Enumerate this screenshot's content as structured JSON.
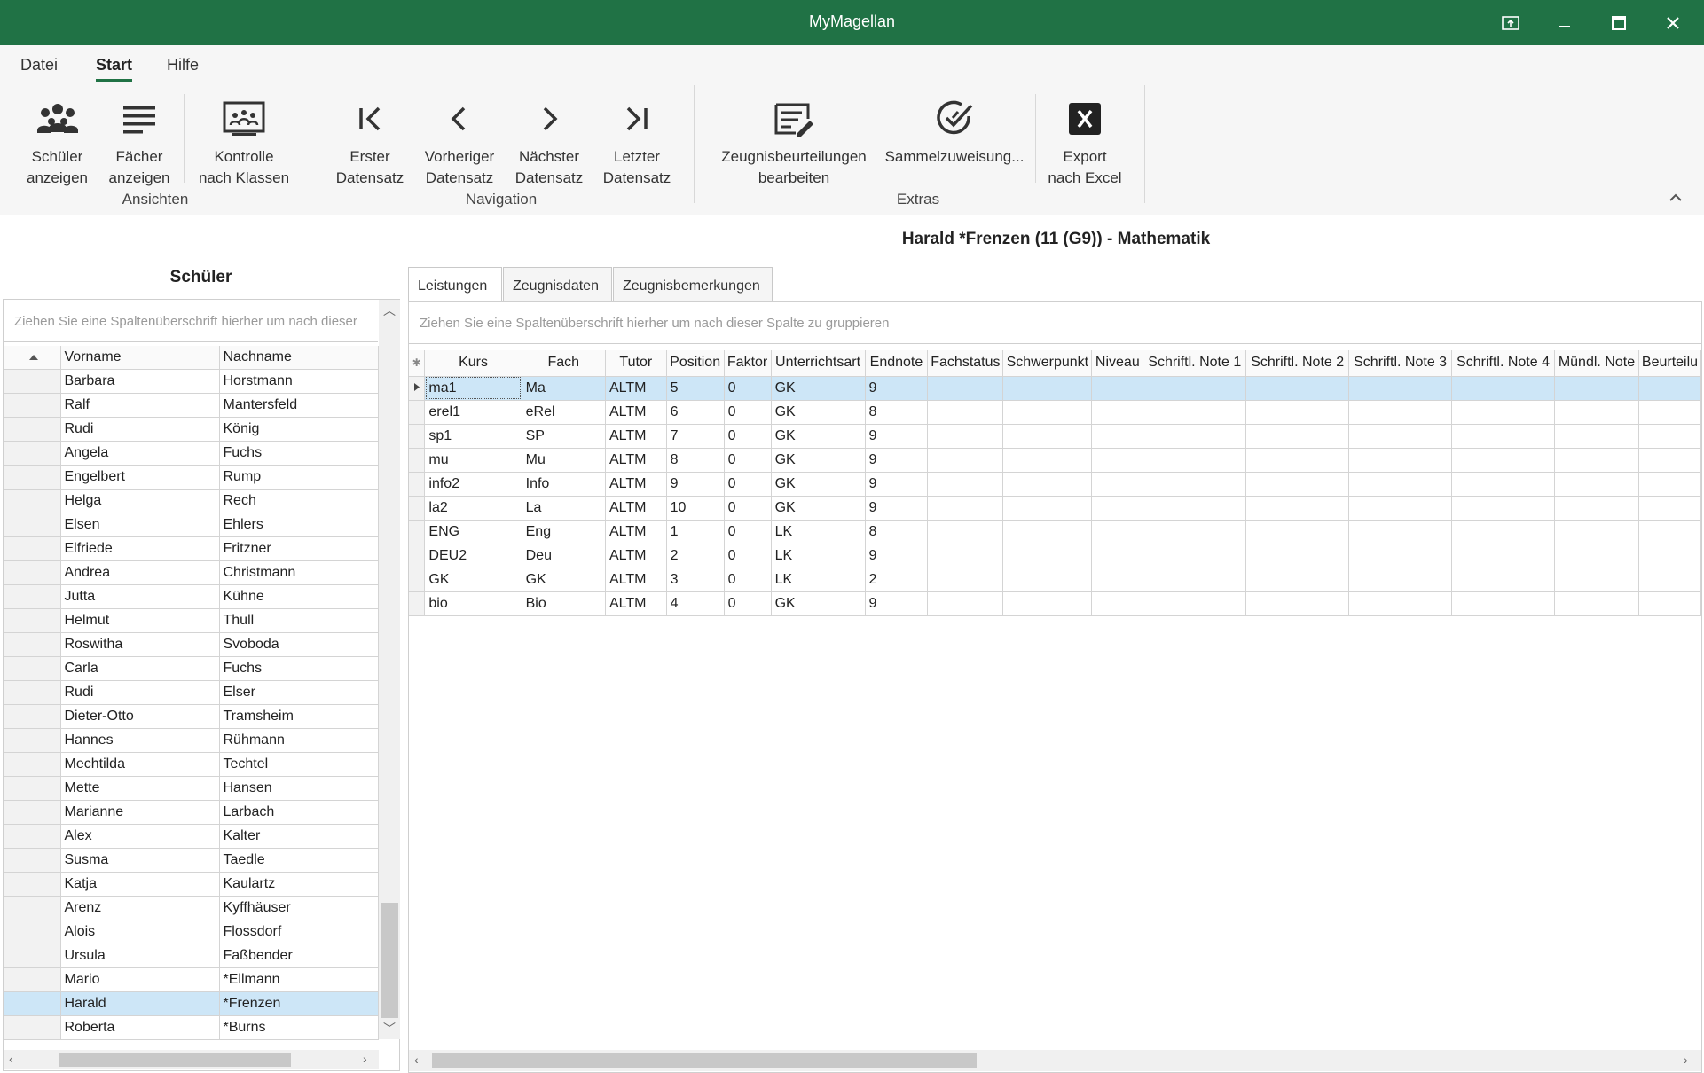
{
  "window": {
    "title": "MyMagellan",
    "controls": [
      "restore-to-tray",
      "minimize",
      "maximize",
      "close"
    ]
  },
  "menu": {
    "tabs": [
      {
        "label": "Datei",
        "active": false
      },
      {
        "label": "Start",
        "active": true
      },
      {
        "label": "Hilfe",
        "active": false
      }
    ]
  },
  "ribbon": {
    "groups": {
      "ansichten": "Ansichten",
      "navigation": "Navigation",
      "extras": "Extras"
    },
    "buttons": {
      "schueler": "Schüler\nanzeigen",
      "faecher": "Fächer\nanzeigen",
      "kontrolle": "Kontrolle\nnach Klassen",
      "erster": "Erster\nDatensatz",
      "vorheriger": "Vorheriger\nDatensatz",
      "naechster": "Nächster\nDatensatz",
      "letzter": "Letzter\nDatensatz",
      "zeugnis": "Zeugnisbeurteilungen\nbearbeiten",
      "sammel": "Sammelzuweisung...",
      "export": "Export\nnach Excel"
    },
    "icons": {
      "schueler": "people-group-icon",
      "faecher": "list-lines-icon",
      "kontrolle": "class-board-icon",
      "erster": "first-record-icon",
      "vorheriger": "previous-record-icon",
      "naechster": "next-record-icon",
      "letzter": "last-record-icon",
      "zeugnis": "edit-document-icon",
      "sammel": "check-circle-icon",
      "export": "excel-icon"
    }
  },
  "record_title": "Harald *Frenzen (11 (G9)) - Mathematik",
  "students": {
    "header": "Schüler",
    "group_hint": "Ziehen Sie eine Spaltenüberschrift hierher um nach dieser",
    "columns": [
      "Vorname",
      "Nachname"
    ],
    "rows": [
      [
        "Barbara",
        "Horstmann"
      ],
      [
        "Ralf",
        "Mantersfeld"
      ],
      [
        "Rudi",
        "König"
      ],
      [
        "Angela",
        "Fuchs"
      ],
      [
        "Engelbert",
        "Rump"
      ],
      [
        "Helga",
        "Rech"
      ],
      [
        "Elsen",
        "Ehlers"
      ],
      [
        "Elfriede",
        "Fritzner"
      ],
      [
        "Andrea",
        "Christmann"
      ],
      [
        "Jutta",
        "Kühne"
      ],
      [
        "Helmut",
        "Thull"
      ],
      [
        "Roswitha",
        "Svoboda"
      ],
      [
        "Carla",
        "Fuchs"
      ],
      [
        "Rudi",
        "Elser"
      ],
      [
        "Dieter-Otto",
        "Tramsheim"
      ],
      [
        "Hannes",
        "Rühmann"
      ],
      [
        "Mechtilda",
        "Techtel"
      ],
      [
        "Mette",
        "Hansen"
      ],
      [
        "Marianne",
        "Larbach"
      ],
      [
        "Alex",
        "Kalter"
      ],
      [
        "Susma",
        "Taedle"
      ],
      [
        "Katja",
        "Kaulartz"
      ],
      [
        "Arenz",
        "Kyffhäuser"
      ],
      [
        "Alois",
        "Flossdorf"
      ],
      [
        "Ursula",
        "Faßbender"
      ],
      [
        "Mario",
        "*Ellmann"
      ],
      [
        "Harald",
        "*Frenzen"
      ],
      [
        "Roberta",
        "*Burns"
      ]
    ],
    "selected_index": 26
  },
  "tabs": [
    {
      "label": "Leistungen",
      "active": true
    },
    {
      "label": "Zeugnisdaten",
      "active": false
    },
    {
      "label": "Zeugnisbemerkungen",
      "active": false
    }
  ],
  "grades": {
    "group_hint": "Ziehen Sie eine Spaltenüberschrift hierher um nach dieser Spalte zu gruppieren",
    "columns": [
      "Kurs",
      "Fach",
      "Tutor",
      "Position",
      "Faktor",
      "Unterrichtsart",
      "Endnote",
      "Fachstatus",
      "Schwerpunkt",
      "Niveau",
      "Schriftl. Note 1",
      "Schriftl. Note 2",
      "Schriftl. Note 3",
      "Schriftl. Note 4",
      "Mündl. Note",
      "Beurteilu"
    ],
    "rows": [
      [
        "ma1",
        "Ma",
        "ALTM",
        "5",
        "0",
        "GK",
        "9"
      ],
      [
        "erel1",
        "eRel",
        "ALTM",
        "6",
        "0",
        "GK",
        "8"
      ],
      [
        "sp1",
        "SP",
        "ALTM",
        "7",
        "0",
        "GK",
        "9"
      ],
      [
        "mu",
        "Mu",
        "ALTM",
        "8",
        "0",
        "GK",
        "9"
      ],
      [
        "info2",
        "Info",
        "ALTM",
        "9",
        "0",
        "GK",
        "9"
      ],
      [
        "la2",
        "La",
        "ALTM",
        "10",
        "0",
        "GK",
        "9"
      ],
      [
        "ENG",
        "Eng",
        "ALTM",
        "1",
        "0",
        "LK",
        "8"
      ],
      [
        "DEU2",
        "Deu",
        "ALTM",
        "2",
        "0",
        "LK",
        "9"
      ],
      [
        "GK",
        "GK",
        "ALTM",
        "3",
        "0",
        "LK",
        "2"
      ],
      [
        "bio",
        "Bio",
        "ALTM",
        "4",
        "0",
        "GK",
        "9"
      ]
    ],
    "selected_index": 0
  },
  "colors": {
    "titlebar": "#207245",
    "selection": "#cde6f7"
  }
}
